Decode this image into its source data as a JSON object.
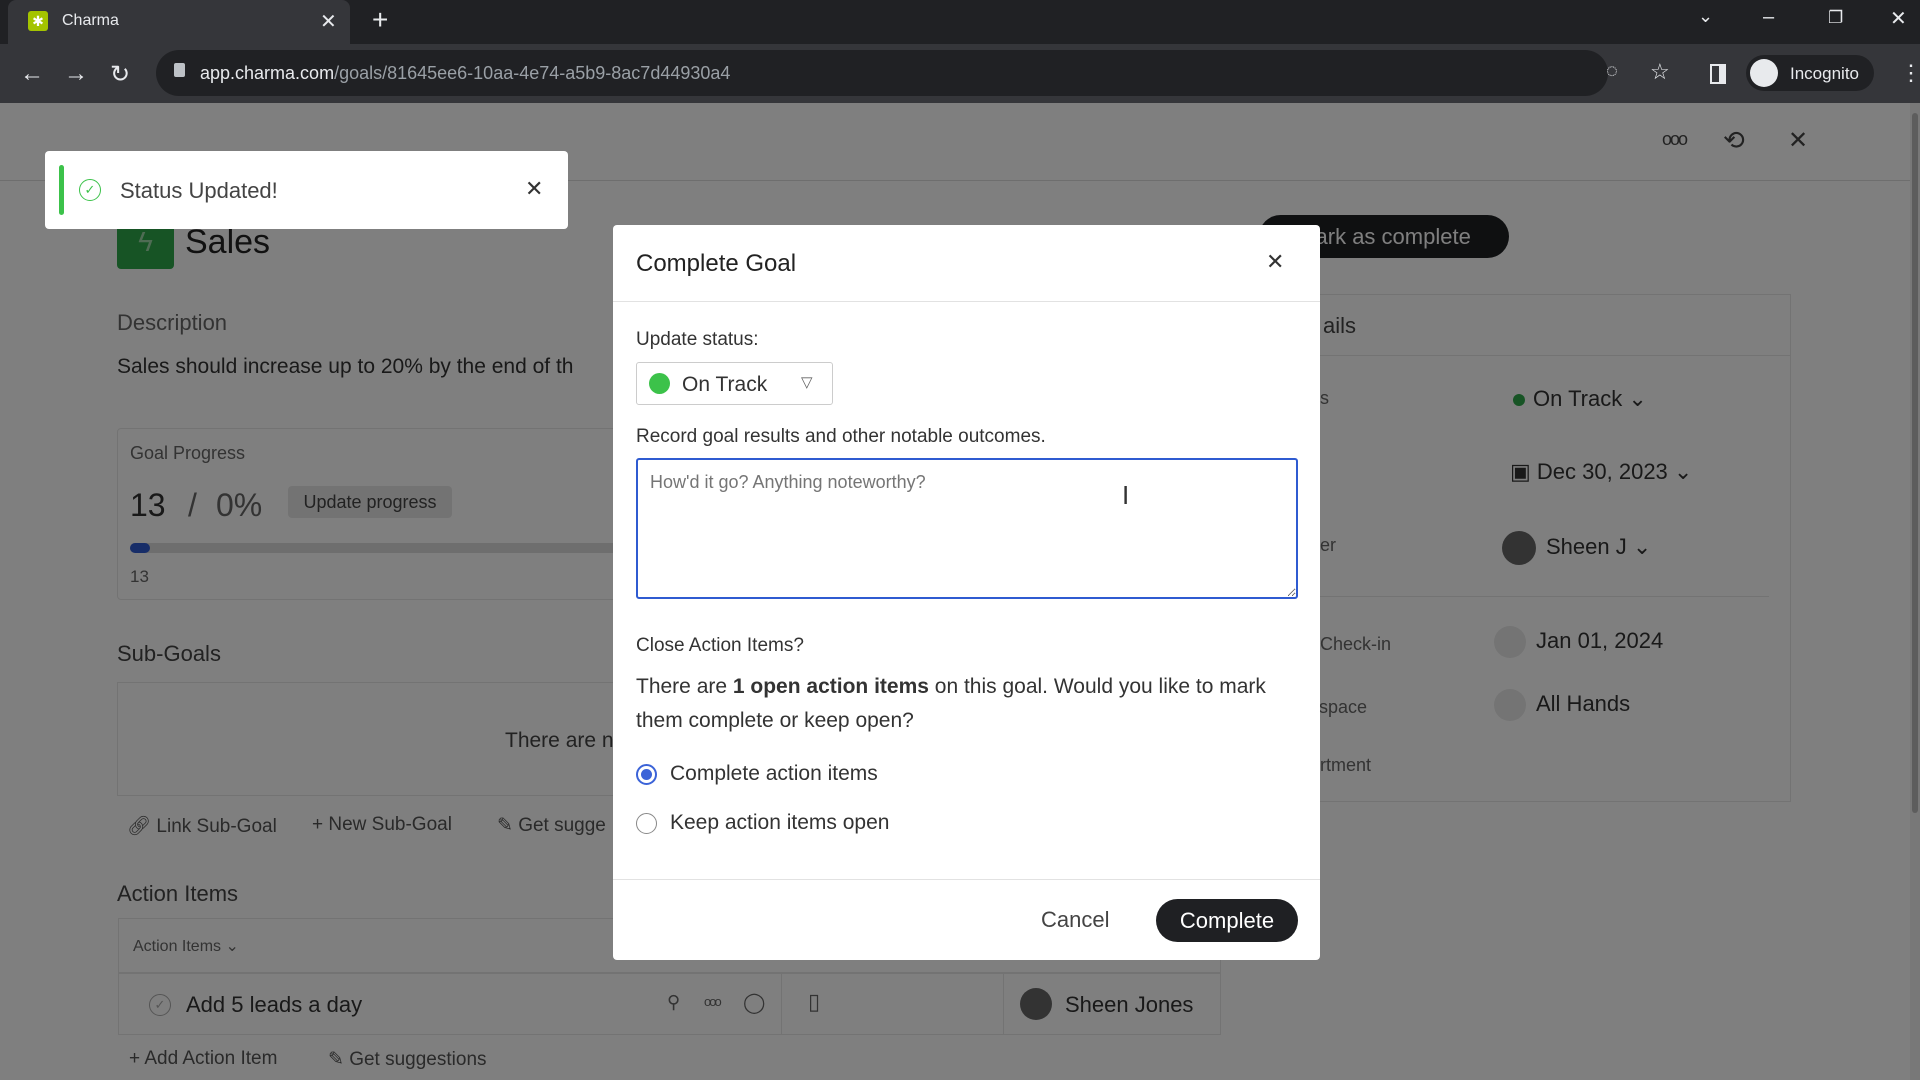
{
  "browser": {
    "tab_title": "Charma",
    "url_host": "app.charma.com",
    "url_path": "/goals/81645ee6-10aa-4e74-a5b9-8ac7d44930a4",
    "profile": "Incognito"
  },
  "toast": {
    "message": "Status Updated!"
  },
  "goal": {
    "title": "Sales",
    "mark_complete_label": "Mark as complete",
    "description_label": "Description",
    "description": "Sales should increase up to 20% by the end of th",
    "progress_label": "Goal Progress",
    "progress_current": "13",
    "progress_sep": "/",
    "progress_target": "0%",
    "update_progress_label": "Update progress",
    "progress_marker": "13",
    "progress_fraction": 0.0,
    "subgoals_label": "Sub-Goals",
    "subgoals_empty": "There are n",
    "link_subgoal": "Link Sub-Goal",
    "new_subgoal": "New Sub-Goal",
    "get_suggestions_sub": "Get sugge",
    "action_items_label": "Action Items",
    "action_items_filter": "Action Items",
    "action_item": {
      "title": "Add 5 leads a day",
      "assignee": "Sheen Jones"
    },
    "add_action_item": "Add Action Item",
    "get_suggestions": "Get suggestions"
  },
  "details": {
    "title": "ails",
    "rows": [
      {
        "label": "us",
        "value": "On Track"
      },
      {
        "label": "",
        "value": "Dec 30, 2023"
      },
      {
        "label": "ner",
        "value": "Sheen J"
      },
      {
        "label": "t Check-in",
        "value": "Jan 01, 2024"
      },
      {
        "label": "kspace",
        "value": "All Hands"
      },
      {
        "label": "artment",
        "value": ""
      }
    ]
  },
  "modal": {
    "title": "Complete Goal",
    "status_label": "Update status:",
    "status_value": "On Track",
    "status_color": "#3cc24a",
    "results_label": "Record goal results and other notable outcomes.",
    "results_placeholder": "How'd it go? Anything noteworthy?",
    "close_items_label": "Close Action Items?",
    "msg_pre": "There are ",
    "msg_bold": "1 open action items",
    "msg_post": " on this goal. Would you like to mark them complete or keep open?",
    "option_complete": "Complete action items",
    "option_keep": "Keep action items open",
    "cancel": "Cancel",
    "complete": "Complete"
  }
}
